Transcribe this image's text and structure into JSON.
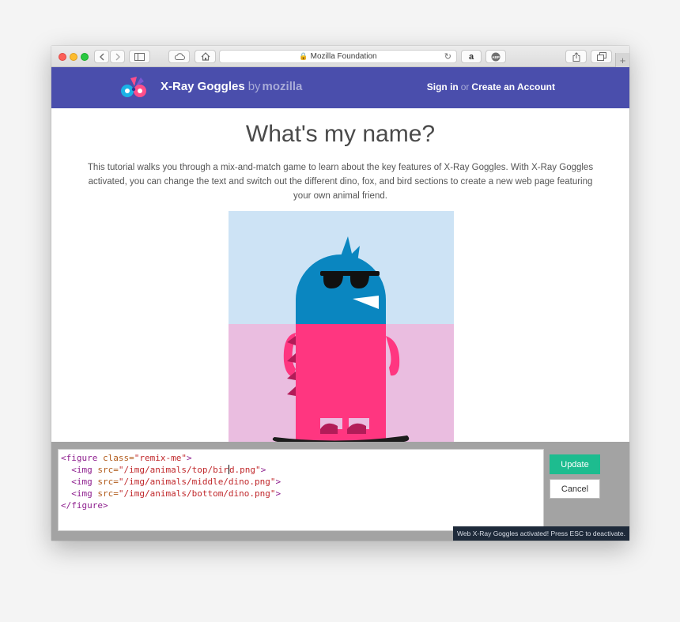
{
  "browser": {
    "address": "Mozilla Foundation"
  },
  "header": {
    "brand": "X-Ray Goggles",
    "by": "by",
    "brand_org": "mozilla",
    "sign_in": "Sign in",
    "or": "or",
    "create_account": "Create an Account"
  },
  "main": {
    "title": "What's my name?",
    "intro": "This tutorial walks you through a mix-and-match game to learn about the key features of X-Ray Goggles. With X-Ray Goggles activated, you can change the text and switch out the different dino, fox, and bird sections to create a new web page featuring your own animal friend."
  },
  "xray": {
    "code": {
      "l1_open": "<figure ",
      "l1_attr": "class=",
      "l1_str": "\"remix-me\"",
      "l1_close": ">",
      "l2_open": "  <img ",
      "l2_attr": "src=",
      "l2_str_a": "\"/img/animals/top/bir",
      "l2_str_b": "d.png\"",
      "l2_close": ">",
      "l3_open": "  <img ",
      "l3_attr": "src=",
      "l3_str": "\"/img/animals/middle/dino.png\"",
      "l3_close": ">",
      "l4_open": "  <img ",
      "l4_attr": "src=",
      "l4_str": "\"/img/animals/bottom/dino.png\"",
      "l4_close": ">",
      "l5": "</figure>"
    },
    "update_label": "Update",
    "cancel_label": "Cancel",
    "status": "Web X-Ray Goggles activated! Press ESC to deactivate."
  },
  "colors": {
    "header_bg": "#4a4eac",
    "update_btn": "#1dbc8f",
    "bird_blue": "#0a86c0",
    "dino_pink": "#ff3680"
  },
  "icons": {
    "back": "chevron-left-icon",
    "forward": "chevron-right-icon",
    "sidebar": "sidebar-icon",
    "cloud": "cloud-icon",
    "home": "home-icon",
    "lock": "lock-icon",
    "reload": "reload-icon",
    "amazon": "amazon-icon",
    "adblock": "adblock-icon",
    "share": "share-icon",
    "tabs": "tabs-icon",
    "new_tab": "plus-icon"
  }
}
